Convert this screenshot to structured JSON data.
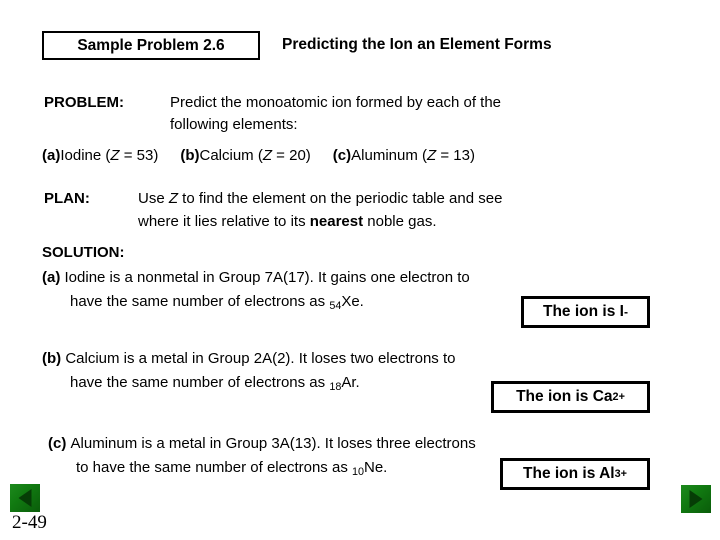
{
  "slide": {
    "page_number": "2-49",
    "header": {
      "badge_label": "Sample Problem 2.6",
      "title": "Predicting the Ion an Element Forms"
    },
    "problem": {
      "label": "PROBLEM:",
      "line1": "Predict the monoatomic ion formed by each of the",
      "line2": "following elements:",
      "items": [
        {
          "marker": "(a)",
          "text": "Iodine (",
          "var": "Z",
          "eq": " = 53)"
        },
        {
          "marker": "(b)",
          "text": "Calcium (",
          "var": "Z",
          "eq": " = 20)"
        },
        {
          "marker": "(c)",
          "text": "Aluminum (",
          "var": "Z",
          "eq": " = 13)"
        }
      ]
    },
    "plan": {
      "label": "PLAN:",
      "line1_pre": "Use ",
      "line1_var": "Z",
      "line1_post": " to find the element on the periodic table and see",
      "line2_pre": "where it lies relative to its ",
      "line2_bold": "nearest",
      "line2_post": " noble gas."
    },
    "solution": {
      "label": "SOLUTION:",
      "parts": [
        {
          "marker": "(a)",
          "line1": "Iodine is a nonmetal in Group 7A(17). It gains one electron to",
          "line2_pre": "have the same number of electrons as ",
          "line2_sub": "54",
          "line2_post": "Xe.",
          "answer_pre": "The ion is I",
          "answer_sup": "-"
        },
        {
          "marker": "(b)",
          "line1": "Calcium is a metal in Group 2A(2). It loses two electrons to",
          "line2_pre": "have the same number of electrons as ",
          "line2_sub": "18",
          "line2_post": "Ar.",
          "answer_pre": "The ion is Ca",
          "answer_sup": "2+"
        },
        {
          "marker": "(c)",
          "line1": "Aluminum is a metal in Group 3A(13). It loses three electrons",
          "line2_pre": "to have the same number of electrons as ",
          "line2_sub": "10",
          "line2_post": "Ne.",
          "answer_pre": "The ion is Al",
          "answer_sup": "3+"
        }
      ]
    },
    "nav": {
      "prev_label": "previous-slide",
      "next_label": "next-slide",
      "button_color": "#117a11",
      "arrow_color": "#063d06"
    }
  }
}
